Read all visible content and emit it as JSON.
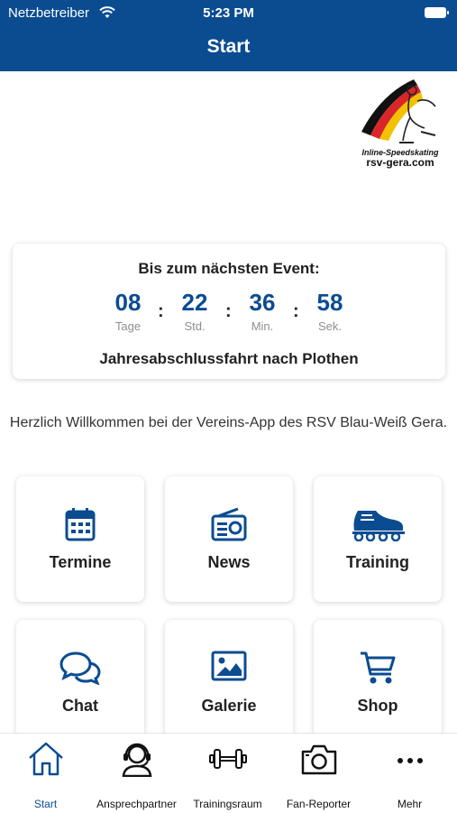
{
  "status_bar": {
    "carrier": "Netzbetreiber",
    "time": "5:23 PM"
  },
  "header": {
    "title": "Start"
  },
  "logo": {
    "line1": "Inline-Speedskating",
    "line2": "rsv-gera.com"
  },
  "event": {
    "heading": "Bis zum nächsten Event:",
    "countdown": [
      {
        "value": "08",
        "unit": "Tage"
      },
      {
        "value": "22",
        "unit": "Std."
      },
      {
        "value": "36",
        "unit": "Min."
      },
      {
        "value": "58",
        "unit": "Sek."
      }
    ],
    "separator": ":",
    "name": "Jahresabschlussfahrt nach Plothen"
  },
  "welcome_text": "Herzlich Willkommen bei der Vereins-App des RSV Blau-Weiß Gera.",
  "tiles": [
    {
      "label": "Termine",
      "icon": "calendar-icon"
    },
    {
      "label": "News",
      "icon": "radio-icon"
    },
    {
      "label": "Training",
      "icon": "inline-skate-icon"
    },
    {
      "label": "Chat",
      "icon": "chat-bubbles-icon"
    },
    {
      "label": "Galerie",
      "icon": "image-icon"
    },
    {
      "label": "Shop",
      "icon": "shopping-cart-icon"
    }
  ],
  "tabbar": [
    {
      "label": "Start",
      "icon": "home-icon",
      "active": true
    },
    {
      "label": "Ansprechpartner",
      "icon": "support-person-icon",
      "active": false
    },
    {
      "label": "Trainingsraum",
      "icon": "dumbbell-icon",
      "active": false
    },
    {
      "label": "Fan-Reporter",
      "icon": "camera-icon",
      "active": false
    },
    {
      "label": "Mehr",
      "icon": "more-dots-icon",
      "active": false
    }
  ],
  "colors": {
    "primary": "#0b4c91",
    "text": "#222222",
    "muted": "#8e8e8e"
  }
}
